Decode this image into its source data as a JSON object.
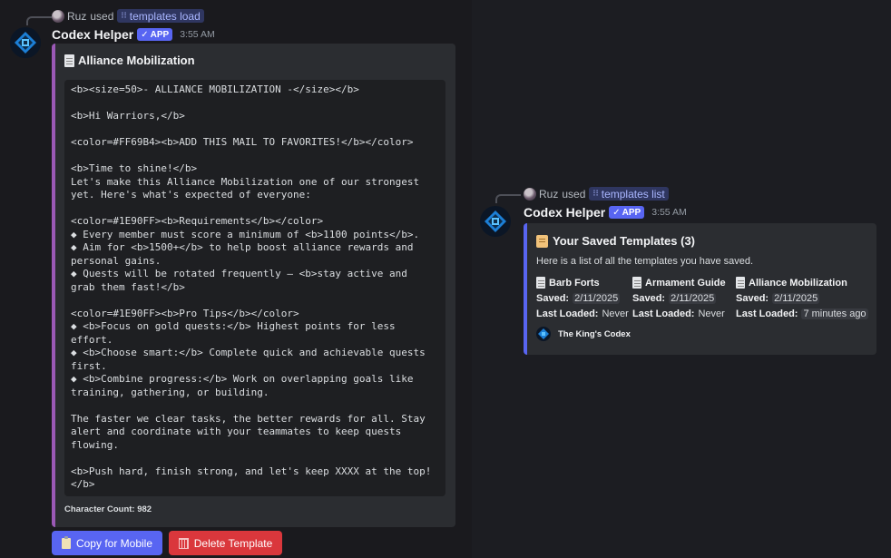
{
  "colors": {
    "background_left": "#1a1a1e",
    "background_right": "#1c1d22",
    "embed_bg": "#2b2d31",
    "embed_left_accent": "#9b59b6",
    "embed_right_accent": "#5865f2",
    "primary_button": "#5865f2",
    "danger_button": "#da373c",
    "command_chip": "#2f3660"
  },
  "left_message": {
    "reply": {
      "user": "Ruz",
      "used_text": "used",
      "command": "templates load"
    },
    "author": {
      "name": "Codex Helper",
      "tag": "APP",
      "timestamp": "3:55 AM"
    },
    "embed": {
      "title": "Alliance Mobilization",
      "code": "<b><size=50>- ALLIANCE MOBILIZATION -</size></b>\n\n<b>Hi Warriors,</b>\n\n<color=#FF69B4><b>ADD THIS MAIL TO FAVORITES!</b></color>\n\n<b>Time to shine!</b>\nLet's make this Alliance Mobilization one of our strongest\nyet. Here's what's expected of everyone:\n\n<color=#1E90FF><b>Requirements</b></color>\n◆ Every member must score a minimum of <b>1100 points</b>.\n◆ Aim for <b>1500+</b> to help boost alliance rewards and\npersonal gains.\n◆ Quests will be rotated frequently — <b>stay active and\ngrab them fast!</b>\n\n<color=#1E90FF><b>Pro Tips</b></color>\n◆ <b>Focus on gold quests:</b> Highest points for less\neffort.\n◆ <b>Choose smart:</b> Complete quick and achievable quests\nfirst.\n◆ <b>Combine progress:</b> Work on overlapping goals like\ntraining, gathering, or building.\n\nThe faster we clear tasks, the better rewards for all. Stay\nalert and coordinate with your teammates to keep quests\nflowing.\n\n<b>Push hard, finish strong, and let's keep XXXX at the top!\n</b>",
      "char_count": "Character Count: 982"
    },
    "buttons": {
      "copy": {
        "label": "Copy for Mobile",
        "icon": "clipboard-icon"
      },
      "delete": {
        "label": "Delete Template",
        "icon": "trash-icon"
      }
    }
  },
  "right_message": {
    "reply": {
      "user": "Ruz",
      "used_text": "used",
      "command": "templates list"
    },
    "author": {
      "name": "Codex Helper",
      "tag": "APP",
      "timestamp": "3:55 AM"
    },
    "embed": {
      "title": "Your Saved Templates (3)",
      "description": "Here is a list of all the templates you have saved.",
      "saved_label": "Saved:",
      "loaded_label": "Last Loaded:",
      "templates": [
        {
          "name": "Barb Forts",
          "saved": "2/11/2025",
          "last_loaded": "Never",
          "loaded_is_code": false
        },
        {
          "name": "Armament Guide",
          "saved": "2/11/2025",
          "last_loaded": "Never",
          "loaded_is_code": false
        },
        {
          "name": "Alliance Mobilization",
          "saved": "2/11/2025",
          "last_loaded": "7 minutes ago",
          "loaded_is_code": true
        }
      ],
      "footer": "The King's Codex"
    }
  }
}
